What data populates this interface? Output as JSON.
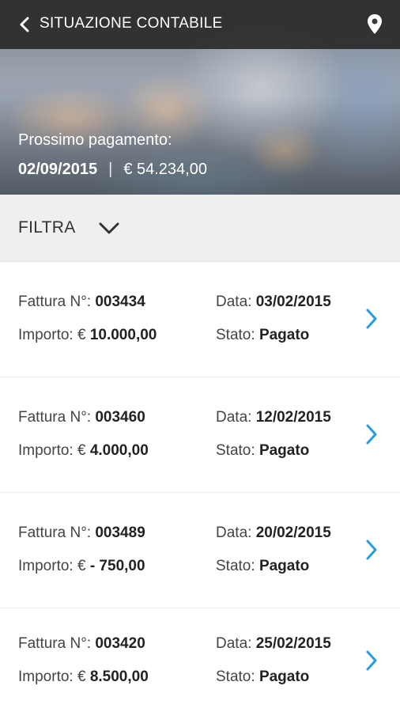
{
  "header": {
    "title": "SITUAZIONE CONTABILE",
    "next_payment_label": "Prossimo pagamento:",
    "next_payment_date": "02/09/2015",
    "separator": "|",
    "next_payment_amount": "€ 54.234,00"
  },
  "filter": {
    "label": "FILTRA"
  },
  "labels": {
    "invoice": "Fattura N°:",
    "amount": "Importo: €",
    "date": "Data:",
    "status": "Stato:"
  },
  "invoices": [
    {
      "number": "003434",
      "amount": "10.000,00",
      "date": "03/02/2015",
      "status": "Pagato"
    },
    {
      "number": "003460",
      "amount": "4.000,00",
      "date": "12/02/2015",
      "status": "Pagato"
    },
    {
      "number": "003489",
      "amount": "- 750,00",
      "date": "20/02/2015",
      "status": "Pagato"
    },
    {
      "number": "003420",
      "amount": "8.500,00",
      "date": "25/02/2015",
      "status": "Pagato"
    }
  ],
  "icons": {
    "back": "chevron-left-icon",
    "location": "map-pin-icon",
    "filter": "chevron-down-icon",
    "row": "chevron-right-icon"
  },
  "colors": {
    "accent": "#2a9be0",
    "topbar": "#282828",
    "filter_bg": "#efefef"
  }
}
